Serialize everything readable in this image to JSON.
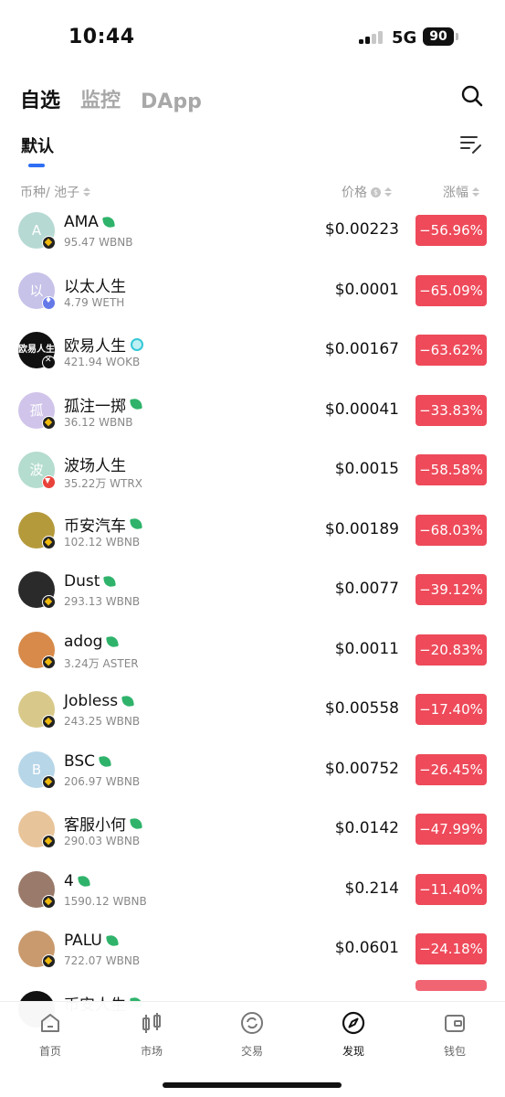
{
  "status": {
    "time": "10:44",
    "network": "5G",
    "battery": "90"
  },
  "header": {
    "tabs": [
      {
        "label": "自选",
        "active": true
      },
      {
        "label": "监控",
        "active": false
      },
      {
        "label": "DApp",
        "active": false
      }
    ],
    "sub_tab": "默认",
    "search_icon": "search-icon",
    "edit_icon": "list-edit-icon"
  },
  "columns": {
    "token": "币种/ 池子",
    "price": "价格",
    "change": "涨幅"
  },
  "colors": {
    "accent": "#2d6ef5",
    "negative": "#ee4a5a"
  },
  "tokens": [
    {
      "name": "AMA",
      "pool": "95.47 WBNB",
      "price": "$0.00223",
      "change": "−56.96%",
      "avatar_text": "A",
      "avatar_color": "#b7d9d3",
      "chain": "bnb",
      "mark": "leaf"
    },
    {
      "name": "以太人生",
      "pool": "4.79 WETH",
      "price": "$0.0001",
      "change": "−65.09%",
      "avatar_text": "以",
      "avatar_color": "#c6c2e8",
      "chain": "eth",
      "mark": ""
    },
    {
      "name": "欧易人生",
      "pool": "421.94 WOKB",
      "price": "$0.00167",
      "change": "−63.62%",
      "avatar_text": "欧易人生",
      "avatar_color": "#111111",
      "chain": "okb",
      "mark": "verified"
    },
    {
      "name": "孤注一掷",
      "pool": "36.12 WBNB",
      "price": "$0.00041",
      "change": "−33.83%",
      "avatar_text": "孤",
      "avatar_color": "#d0c4ea",
      "chain": "bnb",
      "mark": "leaf"
    },
    {
      "name": "波场人生",
      "pool": "35.22万 WTRX",
      "price": "$0.0015",
      "change": "−58.58%",
      "avatar_text": "波",
      "avatar_color": "#b4dccf",
      "chain": "tron",
      "mark": ""
    },
    {
      "name": "币安汽车",
      "pool": "102.12 WBNB",
      "price": "$0.00189",
      "change": "−68.03%",
      "avatar_text": "",
      "avatar_color": "#b59a3c",
      "chain": "bnb",
      "mark": "leaf"
    },
    {
      "name": "Dust",
      "pool": "293.13 WBNB",
      "price": "$0.0077",
      "change": "−39.12%",
      "avatar_text": "",
      "avatar_color": "#2a2a2a",
      "chain": "bnb",
      "mark": "leaf"
    },
    {
      "name": "adog",
      "pool": "3.24万 ASTER",
      "price": "$0.0011",
      "change": "−20.83%",
      "avatar_text": "",
      "avatar_color": "#d78a4a",
      "chain": "bnb",
      "mark": "leaf"
    },
    {
      "name": "Jobless",
      "pool": "243.25 WBNB",
      "price": "$0.00558",
      "change": "−17.40%",
      "avatar_text": "",
      "avatar_color": "#d8c98a",
      "chain": "bnb",
      "mark": "leaf"
    },
    {
      "name": "BSC",
      "pool": "206.97 WBNB",
      "price": "$0.00752",
      "change": "−26.45%",
      "avatar_text": "B",
      "avatar_color": "#b7d6e8",
      "chain": "bnb",
      "mark": "leaf"
    },
    {
      "name": "客服小何",
      "pool": "290.03 WBNB",
      "price": "$0.0142",
      "change": "−47.99%",
      "avatar_text": "",
      "avatar_color": "#e8c49a",
      "chain": "bnb",
      "mark": "leaf"
    },
    {
      "name": "4",
      "pool": "1590.12 WBNB",
      "price": "$0.214",
      "change": "−11.40%",
      "avatar_text": "",
      "avatar_color": "#9a7a6a",
      "chain": "bnb",
      "mark": "leaf"
    },
    {
      "name": "PALU",
      "pool": "722.07 WBNB",
      "price": "$0.0601",
      "change": "−24.18%",
      "avatar_text": "",
      "avatar_color": "#c99a6e",
      "chain": "bnb",
      "mark": "leaf"
    },
    {
      "name": "币安人生",
      "pool": "",
      "price": "",
      "change": "",
      "avatar_text": "",
      "avatar_color": "#111111",
      "chain": "",
      "mark": "leaf"
    }
  ],
  "nav": [
    {
      "label": "首页",
      "icon": "home-icon",
      "active": false
    },
    {
      "label": "市场",
      "icon": "market-icon",
      "active": false
    },
    {
      "label": "交易",
      "icon": "trade-icon",
      "active": false
    },
    {
      "label": "发现",
      "icon": "compass-icon",
      "active": true
    },
    {
      "label": "钱包",
      "icon": "wallet-icon",
      "active": false
    }
  ]
}
